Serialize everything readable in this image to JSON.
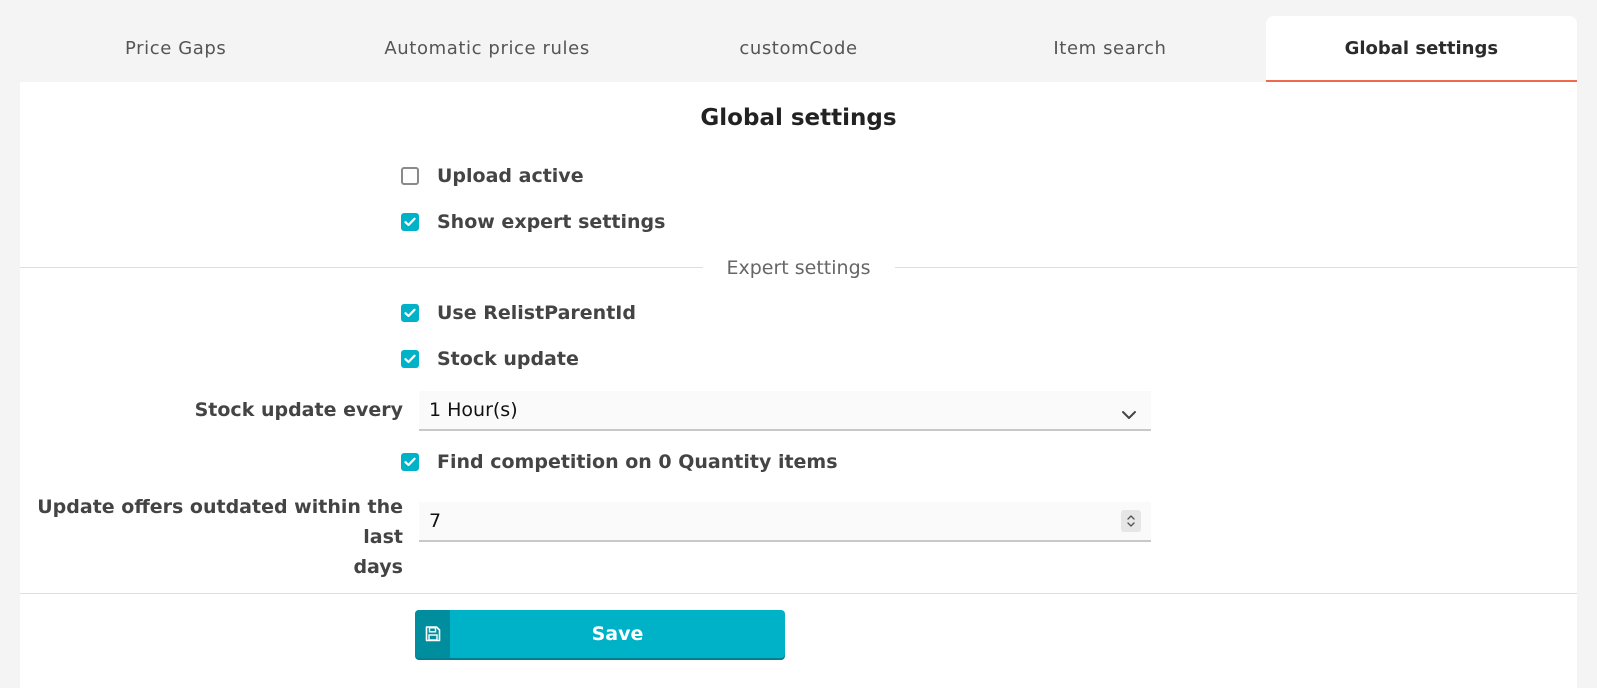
{
  "tabs": [
    {
      "label": "Price Gaps",
      "active": false
    },
    {
      "label": "Automatic price rules",
      "active": false
    },
    {
      "label": "customCode",
      "active": false
    },
    {
      "label": "Item search",
      "active": false
    },
    {
      "label": "Global settings",
      "active": true
    }
  ],
  "panel": {
    "title": "Global settings",
    "upload_active": {
      "label": "Upload active",
      "checked": false
    },
    "show_expert": {
      "label": "Show expert settings",
      "checked": true
    },
    "expert_section_label": "Expert settings",
    "use_relist": {
      "label": "Use RelistParentId",
      "checked": true
    },
    "stock_update": {
      "label": "Stock update",
      "checked": true
    },
    "stock_update_every": {
      "label": "Stock update every",
      "value": "1 Hour(s)"
    },
    "find_competition": {
      "label": "Find competition on 0 Quantity items",
      "checked": true
    },
    "update_offers": {
      "label_line1": "Update offers outdated within the last",
      "label_line2": "days",
      "value": "7"
    },
    "save_label": "Save"
  },
  "colors": {
    "accent": "#00b2c7",
    "tab_indicator": "#f06a4d"
  },
  "icons": {
    "save": "floppy-disk-icon",
    "select": "chevron-down-icon",
    "spinner": "spinner-arrows-icon",
    "check": "checkmark-icon"
  }
}
